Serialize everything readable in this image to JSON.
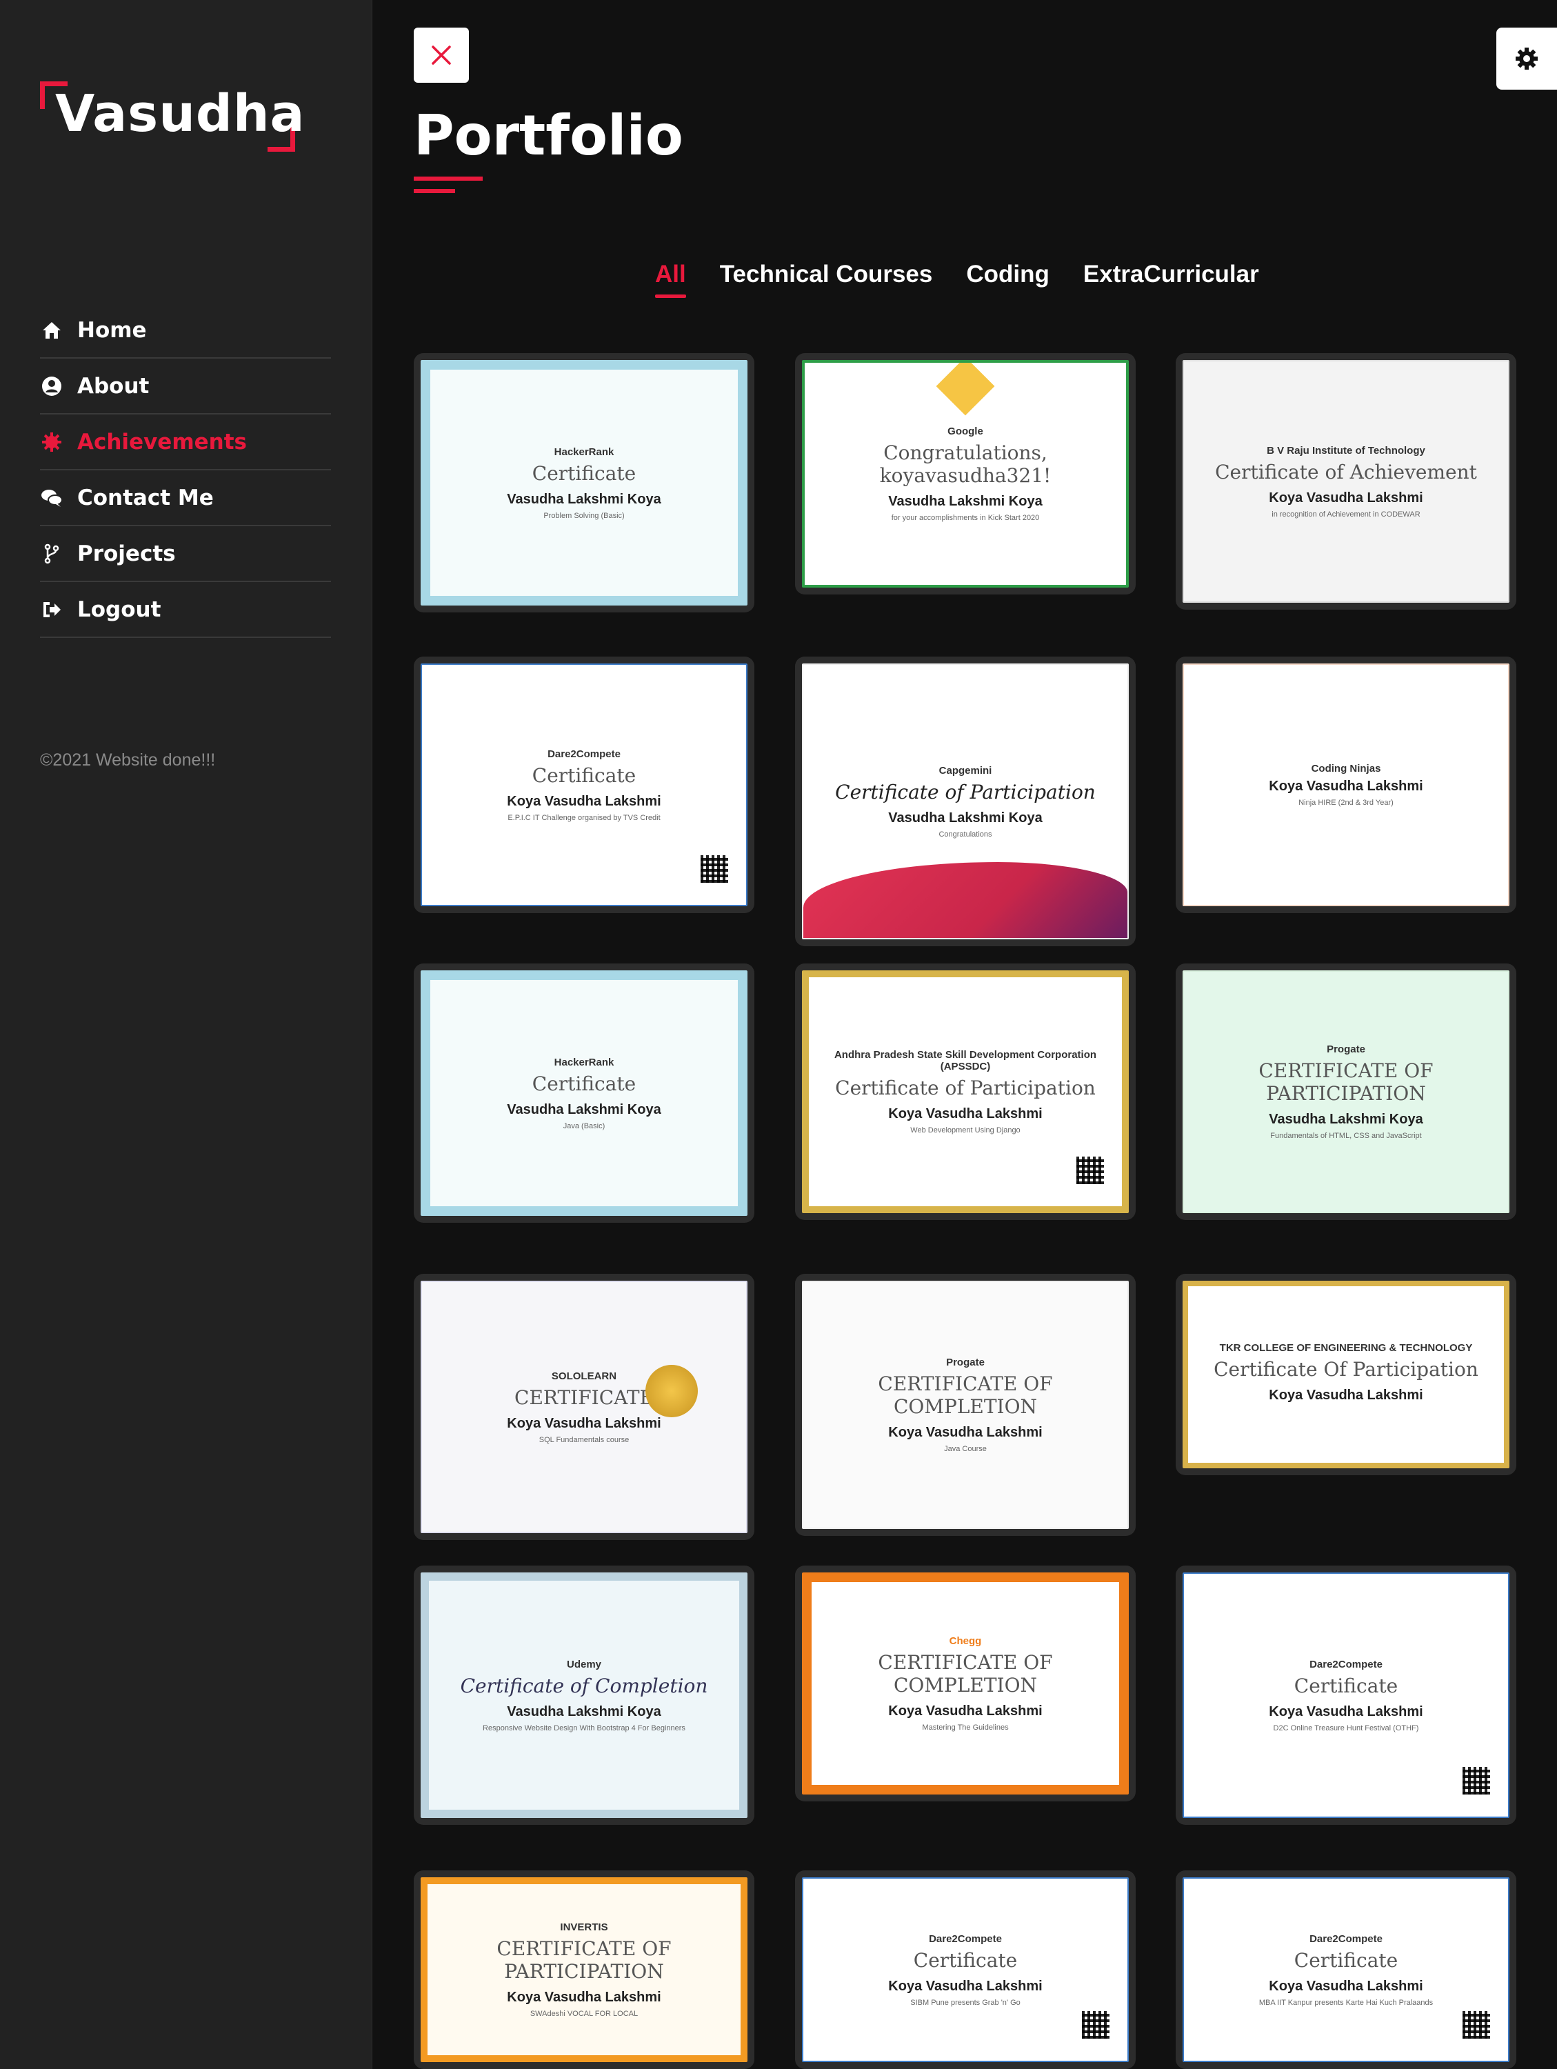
{
  "brand": {
    "name": "Vasudha"
  },
  "nav": [
    {
      "label": "Home",
      "icon": "home-icon",
      "active": false
    },
    {
      "label": "About",
      "icon": "user-icon",
      "active": false
    },
    {
      "label": "Achievements",
      "icon": "badge-icon",
      "active": true
    },
    {
      "label": "Contact Me",
      "icon": "chat-icon",
      "active": false
    },
    {
      "label": "Projects",
      "icon": "code-branch-icon",
      "active": false
    },
    {
      "label": "Logout",
      "icon": "sign-out-icon",
      "active": false
    }
  ],
  "copyright": "©2021 Website done!!!",
  "page": {
    "title": "Portfolio"
  },
  "tabs": [
    {
      "label": "All",
      "active": true
    },
    {
      "label": "Technical Courses",
      "active": false
    },
    {
      "label": "Coding",
      "active": false
    },
    {
      "label": "ExtraCurricular",
      "active": false
    }
  ],
  "colors": {
    "accent": "#e8193c",
    "sidebar": "#222222",
    "main": "#111111",
    "card": "#2c2c2c"
  },
  "certificates": [
    {
      "issuer": "HackerRank",
      "heading": "Certificate",
      "recipient": "Vasudha Lakshmi Koya",
      "detail": "Problem Solving (Basic)",
      "theme": "hackerrank"
    },
    {
      "issuer": "Google",
      "heading": "Congratulations, koyavasudha321!",
      "recipient": "Vasudha Lakshmi Koya",
      "detail": "for your accomplishments in Kick Start 2020",
      "theme": "kickstart"
    },
    {
      "issuer": "B V Raju Institute of Technology",
      "heading": "Certificate of Achievement",
      "recipient": "Koya Vasudha Lakshmi",
      "detail": "in recognition of Achievement in CODEWAR",
      "theme": "bvrit"
    },
    {
      "issuer": "Dare2Compete",
      "heading": "Certificate",
      "recipient": "Koya Vasudha Lakshmi",
      "detail": "E.P.I.C IT Challenge organised by TVS Credit",
      "theme": "d2c"
    },
    {
      "issuer": "Capgemini",
      "heading": "Certificate of Participation",
      "recipient": "Vasudha Lakshmi Koya",
      "detail": "Congratulations",
      "theme": "capgemini"
    },
    {
      "issuer": "Coding Ninjas",
      "heading": "",
      "recipient": "Koya Vasudha Lakshmi",
      "detail": "Ninja HIRE (2nd & 3rd Year)",
      "theme": "ninjas"
    },
    {
      "issuer": "HackerRank",
      "heading": "Certificate",
      "recipient": "Vasudha Lakshmi Koya",
      "detail": "Java (Basic)",
      "theme": "hackerrank"
    },
    {
      "issuer": "Andhra Pradesh State Skill Development Corporation (APSSDC)",
      "heading": "Certificate of Participation",
      "recipient": "Koya Vasudha Lakshmi",
      "detail": "Web Development Using Django",
      "theme": "apssdc"
    },
    {
      "issuer": "Progate",
      "heading": "CERTIFICATE OF PARTICIPATION",
      "recipient": "Vasudha Lakshmi Koya",
      "detail": "Fundamentals of HTML, CSS and JavaScript",
      "theme": "progate"
    },
    {
      "issuer": "SOLOLEARN",
      "heading": "CERTIFICATE",
      "recipient": "Koya Vasudha Lakshmi",
      "detail": "SQL Fundamentals course",
      "theme": "sololearn"
    },
    {
      "issuer": "Progate",
      "heading": "CERTIFICATE OF COMPLETION",
      "recipient": "Koya Vasudha Lakshmi",
      "detail": "Java Course",
      "theme": "progate2"
    },
    {
      "issuer": "TKR COLLEGE OF ENGINEERING & TECHNOLOGY",
      "heading": "Certificate Of Participation",
      "recipient": "Koya Vasudha Lakshmi",
      "detail": "",
      "theme": "tkr"
    },
    {
      "issuer": "Udemy",
      "heading": "Certificate of Completion",
      "recipient": "Vasudha Lakshmi Koya",
      "detail": "Responsive Website Design With Bootstrap 4 For Beginners",
      "theme": "udemy"
    },
    {
      "issuer": "Chegg",
      "heading": "CERTIFICATE OF COMPLETION",
      "recipient": "Koya Vasudha Lakshmi",
      "detail": "Mastering The Guidelines",
      "theme": "chegg"
    },
    {
      "issuer": "Dare2Compete",
      "heading": "Certificate",
      "recipient": "Koya Vasudha Lakshmi",
      "detail": "D2C Online Treasure Hunt Festival (OTHF)",
      "theme": "d2c"
    },
    {
      "issuer": "INVERTIS",
      "heading": "CERTIFICATE OF PARTICIPATION",
      "recipient": "Koya Vasudha Lakshmi",
      "detail": "SWAdeshi VOCAL FOR LOCAL",
      "theme": "invertis"
    },
    {
      "issuer": "Dare2Compete",
      "heading": "Certificate",
      "recipient": "Koya Vasudha Lakshmi",
      "detail": "SIBM Pune presents Grab 'n' Go",
      "theme": "d2c"
    },
    {
      "issuer": "Dare2Compete",
      "heading": "Certificate",
      "recipient": "Koya Vasudha Lakshmi",
      "detail": "MBA IIT Kanpur presents Karte Hai Kuch Pralaands",
      "theme": "d2c"
    }
  ]
}
